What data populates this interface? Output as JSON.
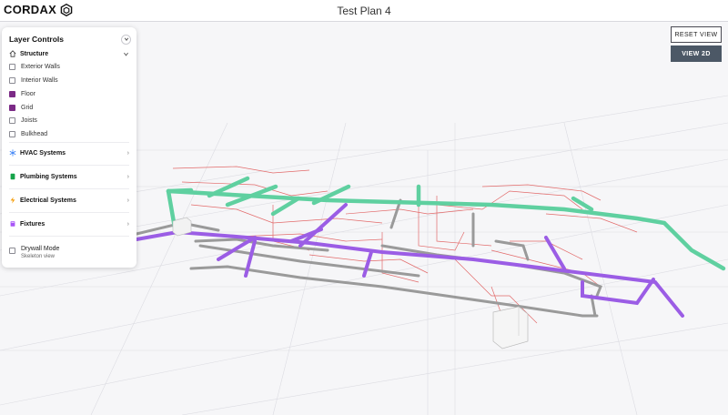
{
  "header": {
    "brand": "CORDAX",
    "title": "Test Plan 4"
  },
  "layer_controls": {
    "title": "Layer Controls",
    "structure": {
      "label": "Structure",
      "items": [
        {
          "label": "Exterior Walls",
          "checked": false
        },
        {
          "label": "Interior Walls",
          "checked": false
        },
        {
          "label": "Floor",
          "checked": true
        },
        {
          "label": "Grid",
          "checked": true
        },
        {
          "label": "Joists",
          "checked": false
        },
        {
          "label": "Bulkhead",
          "checked": false
        }
      ]
    },
    "sections": [
      {
        "label": "HVAC Systems",
        "icon": "snowflake-icon",
        "color": "#3b82f6"
      },
      {
        "label": "Plumbing Systems",
        "icon": "pipe-icon",
        "color": "#16a34a"
      },
      {
        "label": "Electrical Systems",
        "icon": "lightning-icon",
        "color": "#f59e0b"
      },
      {
        "label": "Fixtures",
        "icon": "fixture-icon",
        "color": "#a855f7"
      }
    ],
    "drywall": {
      "label": "Drywall Mode",
      "sublabel": "Skeleton view",
      "checked": false
    }
  },
  "buttons": {
    "reset": "RESET VIEW",
    "view2d": "VIEW 2D"
  },
  "colors": {
    "hvac_duct": "#5fd0a0",
    "plumbing": "#9b5de5",
    "gray_pipe": "#9a9a9a",
    "electrical": "#e05555",
    "selected_checkbox": "#7b2a86",
    "button_dark": "#4c5866"
  }
}
